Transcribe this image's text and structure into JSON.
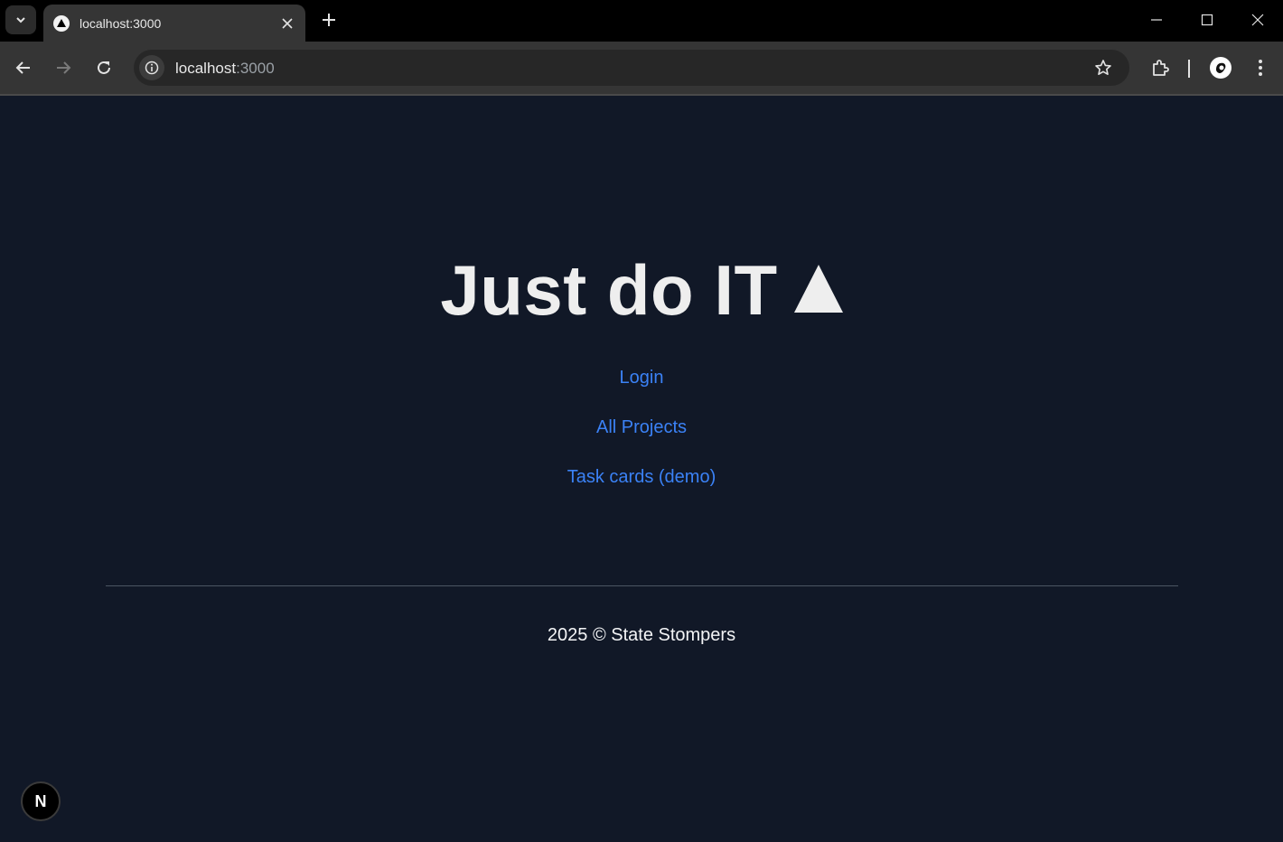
{
  "browser": {
    "tab": {
      "title": "localhost:3000"
    },
    "address": {
      "host": "localhost",
      "port": ":3000"
    }
  },
  "page": {
    "heading": "Just do IT",
    "links": [
      {
        "label": "Login"
      },
      {
        "label": "All Projects"
      },
      {
        "label": "Task cards (demo)"
      }
    ],
    "footer": "2025 © State Stompers",
    "dev_badge": "N"
  },
  "colors": {
    "background": "#111827",
    "link": "#3b82f6",
    "heading": "#eeeeee"
  }
}
